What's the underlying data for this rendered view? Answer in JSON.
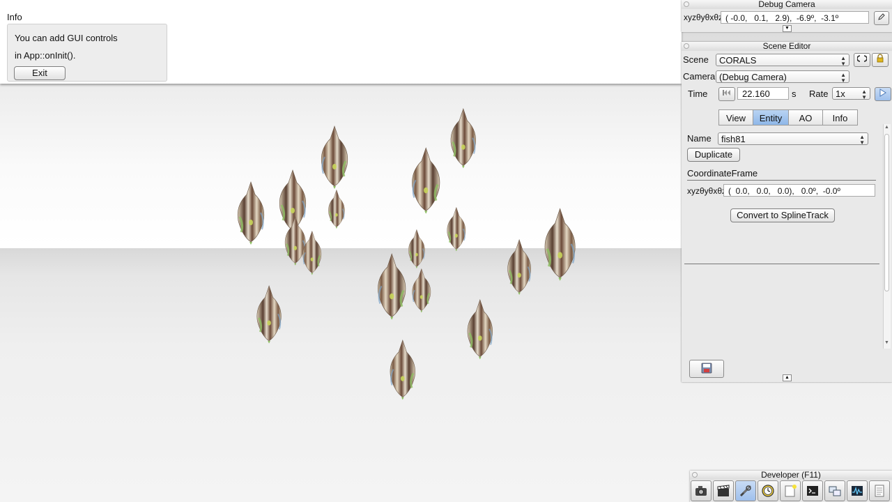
{
  "info": {
    "title": "Info",
    "line1": "You can add GUI controls",
    "line2": "in App::onInit().",
    "exit_label": "Exit"
  },
  "debug_camera": {
    "title": "Debug Camera",
    "xyz_label": "xyzθyθxθz",
    "value": "( -0.0,   0.1,   2.9),  -6.9º,  -3.1º"
  },
  "scene_editor": {
    "title": "Scene Editor",
    "scene_label": "Scene",
    "scene_value": "CORALS",
    "camera_label": "Camera",
    "camera_value": "(Debug Camera)",
    "time_label": "Time",
    "time_value": "22.160",
    "time_unit": "s",
    "rate_label": "Rate",
    "rate_value": "1x",
    "tabs": [
      "View",
      "Entity",
      "AO",
      "Info"
    ],
    "active_tab": "Entity",
    "entity": {
      "name_label": "Name",
      "name_value": "fish81",
      "duplicate_label": "Duplicate",
      "section_label": "CoordinateFrame",
      "xyz_label": "xyzθyθxθz",
      "frame_value": "(  0.0,   0.0,   0.0),   0.0º,  -0.0º",
      "convert_label": "Convert to SplineTrack"
    }
  },
  "developer": {
    "title": "Developer (F11)",
    "tools": [
      "camera-icon",
      "clapperboard-icon",
      "tools-icon",
      "profiler-icon",
      "note-icon",
      "terminal-icon",
      "windows-icon",
      "graph-icon",
      "document-icon"
    ],
    "active_tool": "tools-icon"
  },
  "colors": {
    "accent": "#8eb7e8",
    "panel": "#e9e9e9"
  }
}
